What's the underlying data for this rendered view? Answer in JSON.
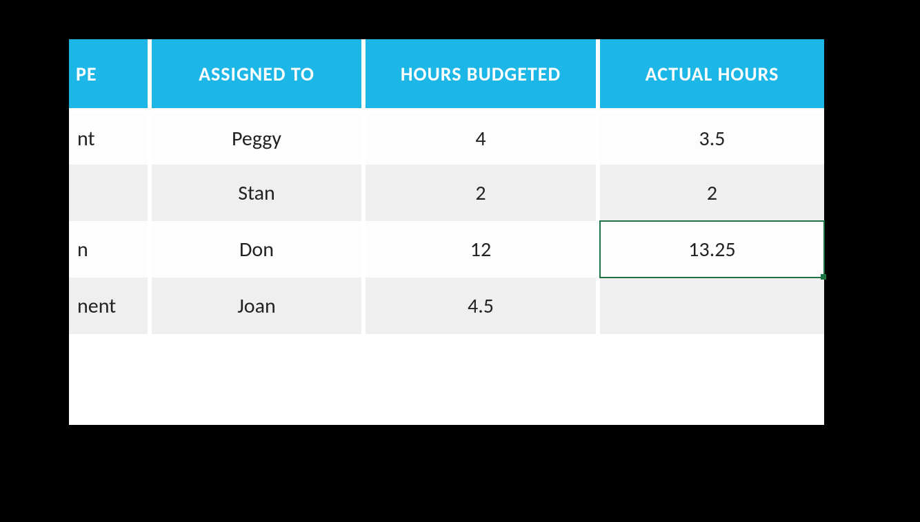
{
  "headers": {
    "type": "PE",
    "assigned": "ASSIGNED TO",
    "budget": "HOURS BUDGETED",
    "actual": "ACTUAL HOURS"
  },
  "rows": [
    {
      "type_frag": "nt",
      "assigned": "Peggy",
      "budget": "4",
      "actual": "3.5"
    },
    {
      "type_frag": "",
      "assigned": "Stan",
      "budget": "2",
      "actual": "2"
    },
    {
      "type_frag": "n",
      "assigned": "Don",
      "budget": "12",
      "actual": "13.25"
    },
    {
      "type_frag": "nent",
      "assigned": "Joan",
      "budget": "4.5",
      "actual": ""
    }
  ],
  "selected": {
    "row": 2,
    "col": "actual"
  },
  "colors": {
    "header_bg": "#1cb6e7",
    "row_alt_bg": "#efefef",
    "selection": "#1e7345"
  }
}
